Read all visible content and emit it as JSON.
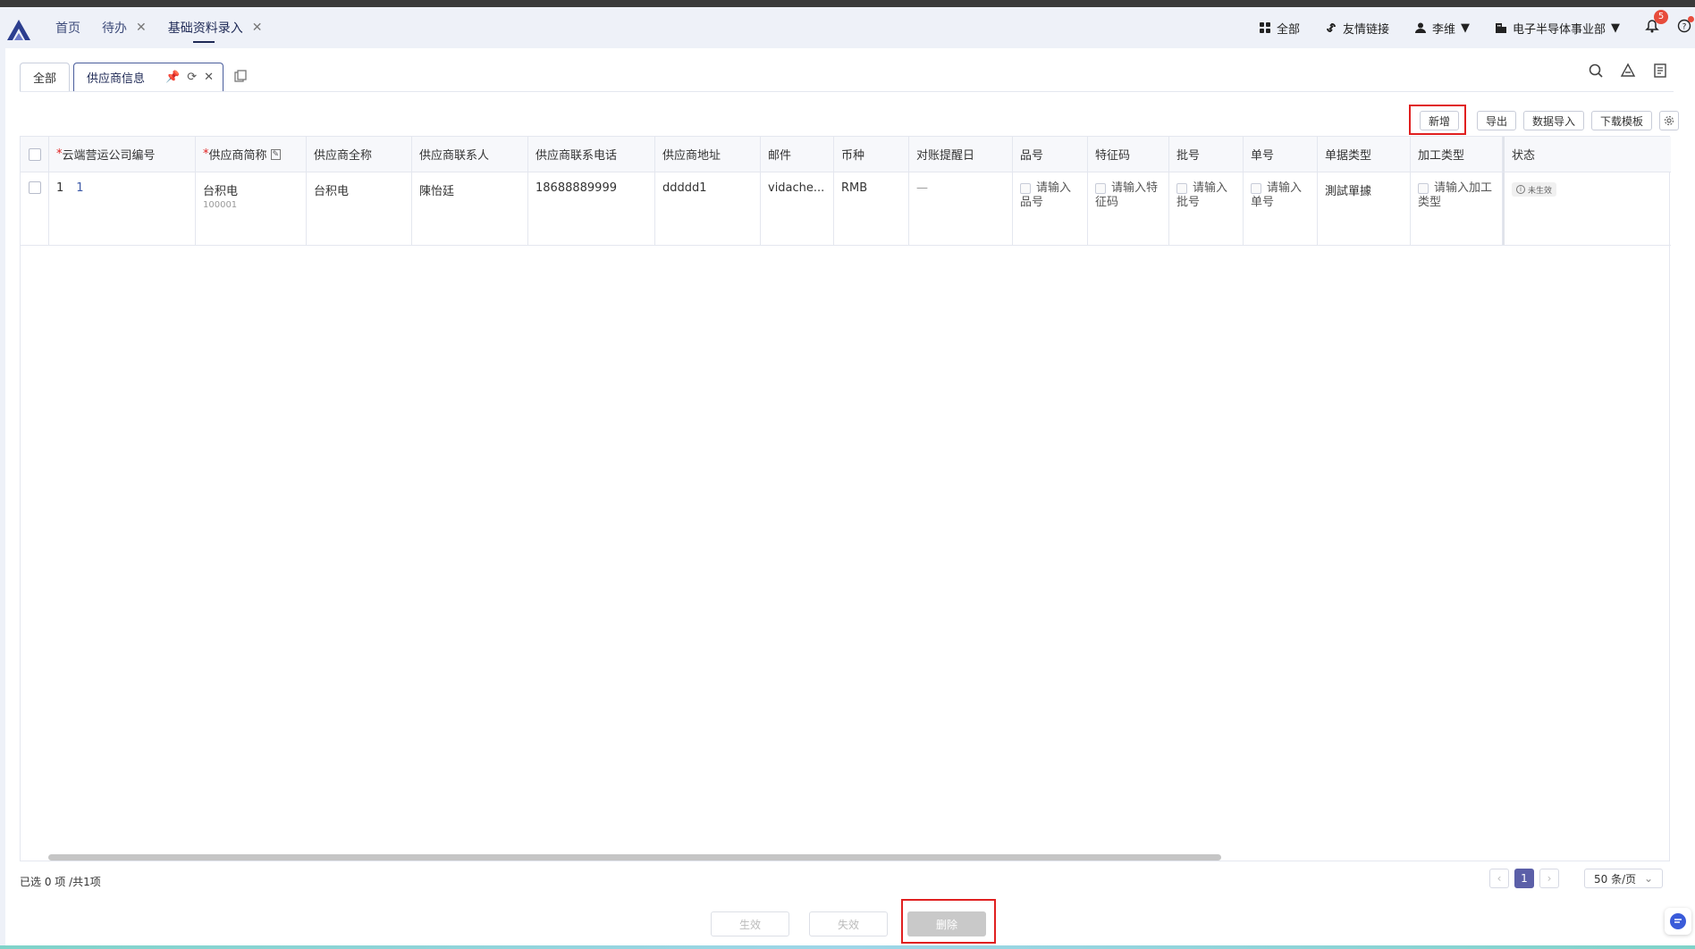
{
  "top_nav": {
    "tabs": [
      {
        "label": "首页"
      },
      {
        "label": "待办"
      },
      {
        "label": "基础资料录入"
      }
    ],
    "right": {
      "all_label": "全部",
      "links_label": "友情链接",
      "user_label": "李维",
      "org_label": "电子半导体事业部",
      "notification_count": "5"
    }
  },
  "page_tabs": {
    "all_label": "全部",
    "supplier_label": "供应商信息"
  },
  "actions": {
    "add": "新增",
    "export": "导出",
    "import": "数据导入",
    "template": "下载模板"
  },
  "table": {
    "columns": [
      {
        "label": "云端营运公司编号",
        "required": true
      },
      {
        "label": "供应商简称",
        "required": true
      },
      {
        "label": "供应商全称"
      },
      {
        "label": "供应商联系人"
      },
      {
        "label": "供应商联系电话"
      },
      {
        "label": "供应商地址"
      },
      {
        "label": "邮件"
      },
      {
        "label": "币种"
      },
      {
        "label": "对账提醒日"
      },
      {
        "label": "品号"
      },
      {
        "label": "特征码"
      },
      {
        "label": "批号"
      },
      {
        "label": "单号"
      },
      {
        "label": "单据类型"
      },
      {
        "label": "加工类型"
      },
      {
        "label": "状态"
      }
    ],
    "rows": [
      {
        "index": "1",
        "company_code": "1",
        "short_name": "台积电",
        "short_code": "100001",
        "full_name": "台积电",
        "contact": "陳怡廷",
        "phone": "18688889999",
        "address": "ddddd1",
        "email": "vidache...",
        "currency": "RMB",
        "reminder_day": "—",
        "item_no": "请输入品号",
        "feature_code": "请输入特征码",
        "batch_no": "请输入批号",
        "doc_no": "请输入单号",
        "doc_type": "測試單據",
        "process_type": "请输入加工类型",
        "status": "未生效"
      }
    ]
  },
  "footer": {
    "selected_text": "已选 0 项 /共1项",
    "current_page": "1",
    "page_size": "50 条/页"
  },
  "bottom_buttons": {
    "activate": "生效",
    "deactivate": "失效",
    "delete": "删除"
  },
  "colors": {
    "accent": "#5b5fa8",
    "nav_bg": "#eef1f8",
    "highlight": "#e02020"
  }
}
